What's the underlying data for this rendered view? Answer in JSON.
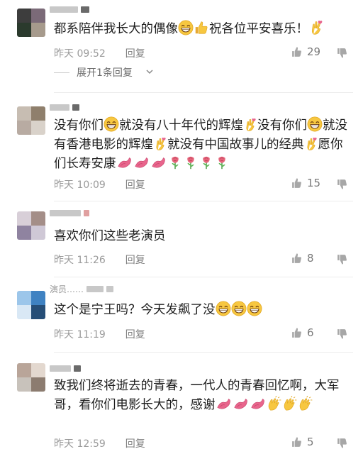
{
  "comments": [
    {
      "text_parts": [
        "都系陪伴我长大的偶像",
        "",
        "",
        "祝各位平安喜乐！",
        ""
      ],
      "time": "昨天 09:52",
      "reply_label": "回复",
      "likes": "29"
    },
    {
      "text_parts": [
        "没有你们",
        "",
        "就没有八十年代的辉煌",
        "",
        "没有你们",
        "",
        "就没有香港电影的辉煌",
        "",
        "就没有中国故事儿的经典",
        "",
        "愿你们长寿安康"
      ],
      "time": "昨天 10:09",
      "reply_label": "回复",
      "likes": "15"
    },
    {
      "text_parts": [
        "喜欢你们这些老演员"
      ],
      "time": "昨天 11:26",
      "reply_label": "回复",
      "likes": "8"
    },
    {
      "username_partial": "演员……",
      "text_parts": [
        "这个是宁王吗？今天发飙了没"
      ],
      "time": "昨天 11:19",
      "reply_label": "回复",
      "likes": "6"
    },
    {
      "text_parts": [
        "致我们终将逝去的青春，一代人的青春回忆啊，大军哥，看你们电影长大的，感谢"
      ],
      "time": "昨天 12:59",
      "reply_label": "回复",
      "likes": "5"
    }
  ],
  "expand_replies": "展开1条回复",
  "colors": {
    "text": "#1e1e1e",
    "meta": "#9a9a9a",
    "emoji_yellow": "#f6c543",
    "emoji_pink": "#e8658c",
    "rose": "#e5647a"
  }
}
